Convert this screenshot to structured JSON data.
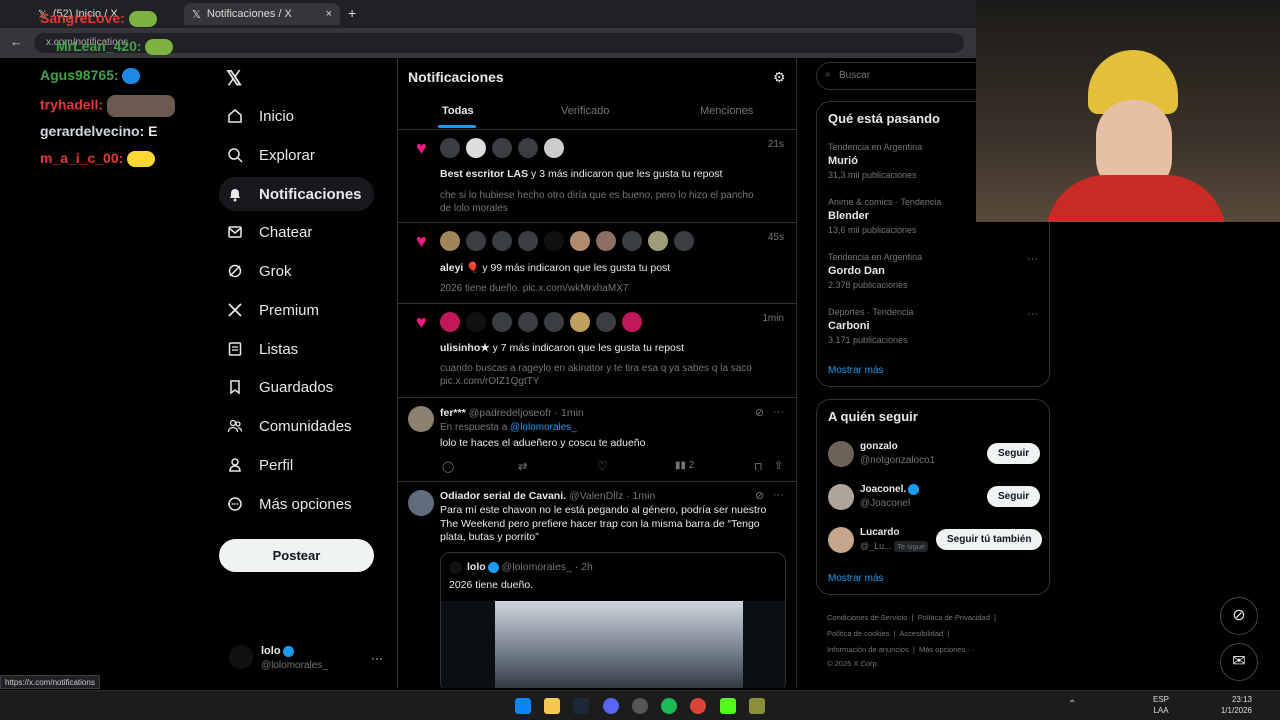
{
  "browser": {
    "tab_inactive": "(52) Inicio / X",
    "tab_active": "Notificaciones / X",
    "url": "x.com/notifications",
    "status_url": "https://x.com/notifications"
  },
  "chat": [
    {
      "name": "SangreLove:",
      "color": "#e53935"
    },
    {
      "name": "MrLean_420:",
      "color": "#43a047"
    },
    {
      "name": "Agus98765:",
      "color": "#43a047"
    },
    {
      "name": "tryhadell:",
      "color": "#e53935"
    },
    {
      "name": "gerardelvecino:",
      "color": "#cfd8dc",
      "msg": "E"
    },
    {
      "name": "m_a_i_c_00:",
      "color": "#e53935"
    }
  ],
  "nav": {
    "items": [
      "Inicio",
      "Explorar",
      "Notificaciones",
      "Chatear",
      "Grok",
      "Premium",
      "Listas",
      "Guardados",
      "Comunidades",
      "Perfil",
      "Más opciones"
    ],
    "post_label": "Postear"
  },
  "account": {
    "name": "lolo",
    "handle": "@lolomorales_"
  },
  "header": {
    "title": "Notificaciones",
    "tabs": [
      "Todas",
      "Verificado",
      "Menciones"
    ]
  },
  "notifications": [
    {
      "time": "21s",
      "who": "Best escritor LAS",
      "rest": "y 3 más indicaron que les gusta tu repost",
      "body": "che si lo hubiese hecho otro diría que es bueno, pero lo hizo el pancho de lolo morales"
    },
    {
      "time": "45s",
      "who": "aleyi",
      "rest": "y 99 más indicaron que les gusta tu post",
      "body": "2026 tiene dueño. pic.x.com/wkMrxhaMX7"
    },
    {
      "time": "1min",
      "who": "ulisinho★",
      "rest": "y 7 más indicaron que les gusta tu repost",
      "body": "cuando buscas a rageylo en akinator y te tira esa q ya sabes q la saco pic.x.com/rOIZ1QgtTY"
    }
  ],
  "reply": {
    "name": "fer***",
    "meta": "@padredeljoseofr · 1min",
    "reply_to": "En respuesta a",
    "mention": "@lolomorales_",
    "text": "lolo te haces el adueñero y coscu te adueño",
    "views": "2"
  },
  "tweet": {
    "name": "Odiador serial de Cavani.",
    "meta": "@ValenDllz · 1min",
    "text": "Para mí este chavon no le está pegando al género, podría ser nuestro The Weekend pero prefiere hacer trap con la misma barra de “Tengo plata, butas y porrito”",
    "quote_name": "lolo",
    "quote_meta": "@lolomorales_ · 2h",
    "quote_text": "2026 tiene dueño."
  },
  "search": {
    "placeholder": "Buscar"
  },
  "trends": {
    "title": "Qué está pasando",
    "items": [
      {
        "ctx": "Tendencia en Argentina",
        "name": "Murió",
        "count": "31,3 mil publicaciones"
      },
      {
        "ctx": "Anime & comics · Tendencia",
        "name": "Blender",
        "count": "13,6 mil publicaciones"
      },
      {
        "ctx": "Tendencia en Argentina",
        "name": "Gordo Dan",
        "count": "2.378 publicaciones"
      },
      {
        "ctx": "Deportes · Tendencia",
        "name": "Carboni",
        "count": "3.171 publicaciones"
      }
    ],
    "more": "Mostrar más"
  },
  "follow": {
    "title": "A quién seguir",
    "items": [
      {
        "name": "gonzalo",
        "handle": "@notgonzaloco1",
        "btn": "Seguir"
      },
      {
        "name": "Joaconel.",
        "handle": "@Joaconel",
        "btn": "Seguir"
      },
      {
        "name": "Lucardo",
        "handle": "@_Lu...",
        "badge": "Te sigue",
        "btn": "Seguir tú también"
      }
    ],
    "more": "Mostrar más"
  },
  "footer": {
    "l1a": "Condiciones de Servicio",
    "l1b": "Política de Privacidad",
    "l2a": "Política de cookies",
    "l2b": "Accesibilidad",
    "l3a": "Información de anuncios",
    "l3b": "Más opciones ···",
    "copy": "© 2026 X Corp."
  },
  "system": {
    "lang": "ESP",
    "lang2": "LAA",
    "time": "23:13",
    "date": "1/1/2026"
  }
}
